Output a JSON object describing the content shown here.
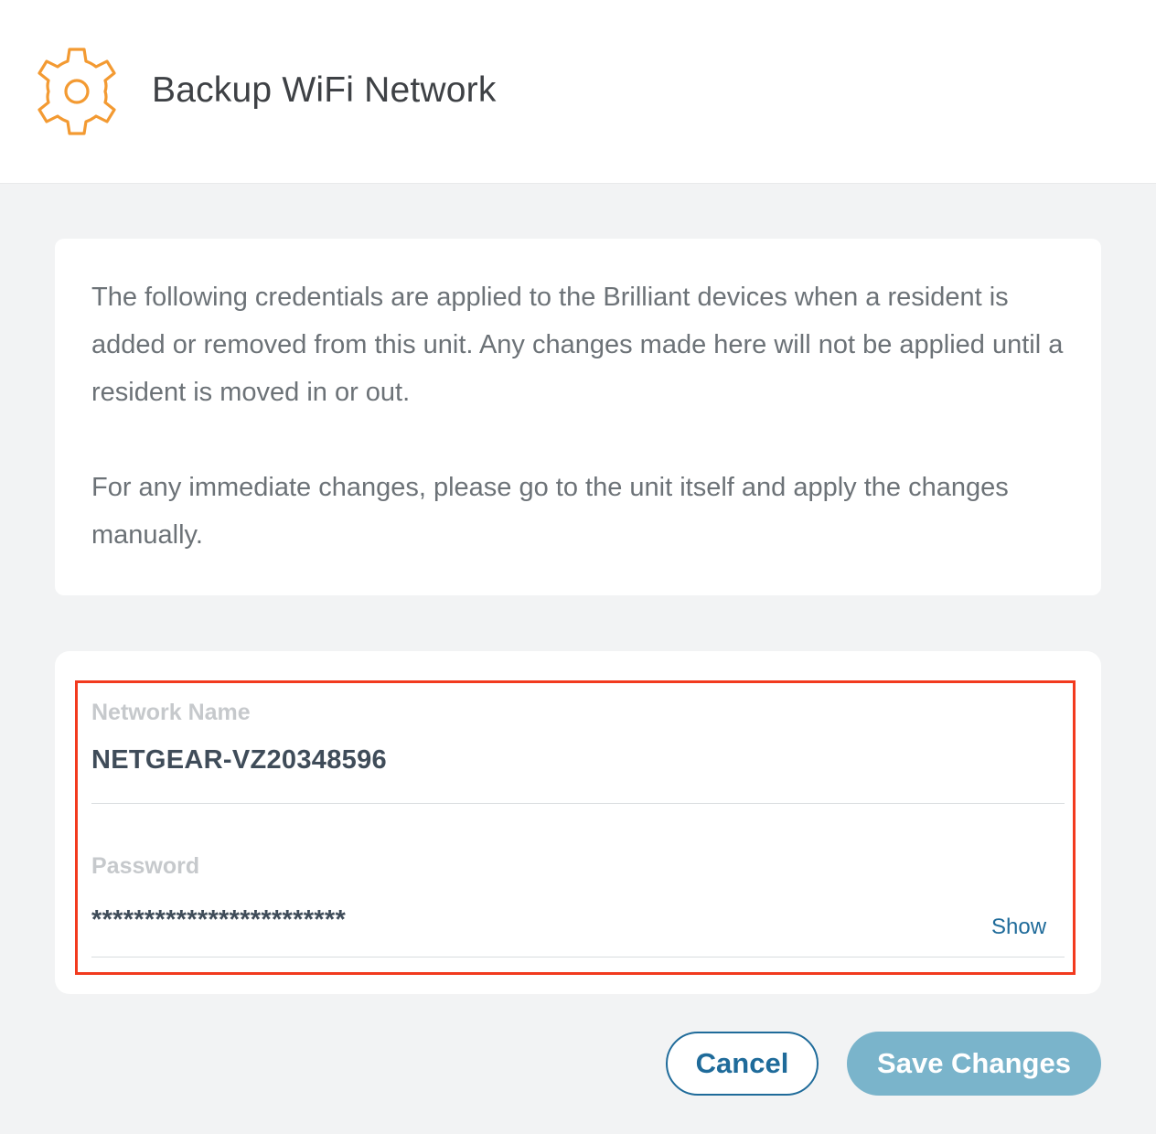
{
  "header": {
    "icon": "gear-icon",
    "title": "Backup WiFi Network"
  },
  "info": {
    "paragraph1": "The following credentials are applied to the Brilliant devices when a resident is added or removed from this unit. Any changes made here will not be applied until a resident is moved in or out.",
    "paragraph2": "For any immediate changes, please go to the unit itself and apply the changes manually."
  },
  "form": {
    "network_name": {
      "label": "Network Name",
      "value": "NETGEAR-VZ20348596"
    },
    "password": {
      "label": "Password",
      "value": "************************",
      "show_label": "Show"
    }
  },
  "actions": {
    "cancel_label": "Cancel",
    "save_label": "Save Changes"
  },
  "colors": {
    "accent_orange": "#f39a32",
    "link_blue": "#1f6b9a",
    "save_button": "#7ab4cb",
    "highlight_red": "#f23a1e"
  }
}
